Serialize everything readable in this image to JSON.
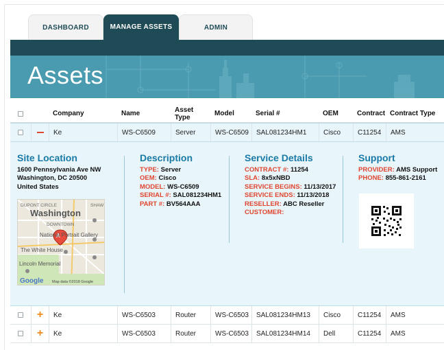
{
  "tabs": [
    {
      "label": "DASHBOARD",
      "active": false
    },
    {
      "label": "MANAGE ASSETS",
      "active": true
    },
    {
      "label": "ADMIN",
      "active": false
    }
  ],
  "page": {
    "title": "Assets"
  },
  "table": {
    "columns": [
      "Company",
      "Name",
      "Asset Type",
      "Model",
      "Serial #",
      "OEM",
      "Contract",
      "Contract Type"
    ],
    "rows": [
      {
        "expanded": true,
        "company": "Ke",
        "name": "WS-C6509",
        "asset_type": "Server",
        "model": "WS-C6509",
        "serial": "SAL081234HM1",
        "oem": "Cisco",
        "contract": "C11254",
        "contract_type": "AMS"
      },
      {
        "expanded": false,
        "company": "Ke",
        "name": "WS-C6503",
        "asset_type": "Router",
        "model": "WS-C6503",
        "serial": "SAL081234HM13",
        "oem": "Cisco",
        "contract": "C11254",
        "contract_type": "AMS"
      },
      {
        "expanded": false,
        "company": "Ke",
        "name": "WS-C6503",
        "asset_type": "Router",
        "model": "WS-C6503",
        "serial": "SAL081234HM14",
        "oem": "Dell",
        "contract": "C11254",
        "contract_type": "AMS"
      }
    ]
  },
  "detail": {
    "site": {
      "title": "Site Location",
      "address_line1": "1600 Pennsylvania Ave NW",
      "address_line2": "Washington, DC 20500",
      "address_line3": "United States",
      "map": {
        "label_city": "Washington",
        "label_dupont": "DUPONT CIRCLE",
        "label_shaw": "SHAW",
        "label_downtown": "DOWNTOWN",
        "label_gallery": "National Portrait Gallery",
        "label_whitehouse": "The White House",
        "label_lincoln": "Lincoln Memorial",
        "label_google": "Google",
        "label_mapdata": "Map data ©2018 Google",
        "marker": "A"
      }
    },
    "description": {
      "title": "Description",
      "items": [
        {
          "label": "TYPE:",
          "value": "Server"
        },
        {
          "label": "OEM:",
          "value": "Cisco"
        },
        {
          "label": "MODEL:",
          "value": "WS-C6509"
        },
        {
          "label": "SERIAL #:",
          "value": "SAL081234HM1"
        },
        {
          "label": "PART #:",
          "value": "BV564AAA"
        }
      ]
    },
    "service": {
      "title": "Service Details",
      "items": [
        {
          "label": "CONTRACT #:",
          "value": "11254"
        },
        {
          "label": "SLA:",
          "value": "8x5xNBD"
        },
        {
          "label": "SERVICE BEGINS:",
          "value": "11/13/2017"
        },
        {
          "label": "SERVICE ENDS:",
          "value": "11/13/2018"
        },
        {
          "label": "RESELLER:",
          "value": "ABC Reseller"
        },
        {
          "label": "CUSTOMER:",
          "value": ""
        }
      ]
    },
    "support": {
      "title": "Support",
      "items": [
        {
          "label": "PROVIDER:",
          "value": "AMS Support"
        },
        {
          "label": "PHONE:",
          "value": "855-861-2161"
        }
      ]
    }
  },
  "colors": {
    "brand_dark": "#1f4b57",
    "hero": "#4a9bb0",
    "accent_red": "#e0452f",
    "accent_orange": "#f08a1c",
    "title_blue": "#1a7aa8",
    "expanded_bg": "#e8f5fa"
  }
}
